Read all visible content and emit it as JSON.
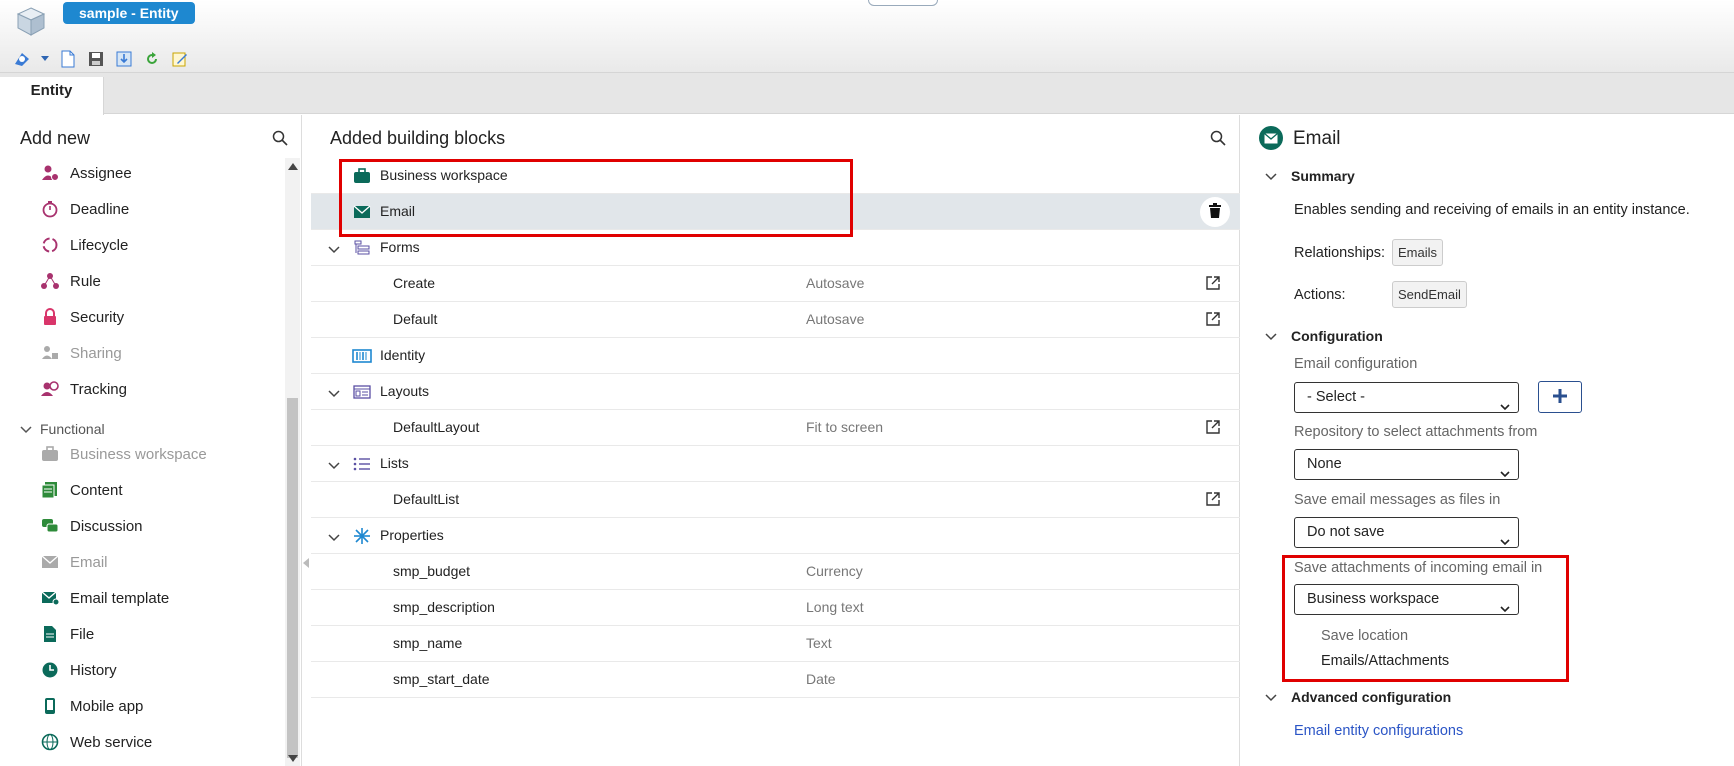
{
  "window": {
    "title": "sample - Entity"
  },
  "tabs": [
    {
      "label": "Entity",
      "active": true
    }
  ],
  "left_panel": {
    "title": "Add new",
    "items": [
      {
        "label": "Assignee",
        "icon": "person-check-icon",
        "disabled": false
      },
      {
        "label": "Deadline",
        "icon": "stopwatch-icon",
        "disabled": false
      },
      {
        "label": "Lifecycle",
        "icon": "cycle-icon",
        "disabled": false
      },
      {
        "label": "Rule",
        "icon": "rule-icon",
        "disabled": false
      },
      {
        "label": "Security",
        "icon": "lock-icon",
        "disabled": false
      },
      {
        "label": "Sharing",
        "icon": "sharing-icon",
        "disabled": true
      },
      {
        "label": "Tracking",
        "icon": "tracking-icon",
        "disabled": false
      }
    ],
    "group_label": "Functional",
    "functional_items": [
      {
        "label": "Business workspace",
        "icon": "briefcase-icon",
        "disabled": true
      },
      {
        "label": "Content",
        "icon": "content-icon",
        "disabled": false
      },
      {
        "label": "Discussion",
        "icon": "chat-icon",
        "disabled": false
      },
      {
        "label": "Email",
        "icon": "envelope-icon",
        "disabled": true
      },
      {
        "label": "Email template",
        "icon": "email-template-icon",
        "disabled": false
      },
      {
        "label": "File",
        "icon": "file-icon",
        "disabled": false
      },
      {
        "label": "History",
        "icon": "clock-icon",
        "disabled": false
      },
      {
        "label": "Mobile app",
        "icon": "mobile-icon",
        "disabled": false
      },
      {
        "label": "Web service",
        "icon": "globe-icon",
        "disabled": false
      }
    ]
  },
  "middle_panel": {
    "title": "Added building blocks",
    "rows": [
      {
        "label": "Business workspace",
        "meta": "",
        "level": 0,
        "expandable": false,
        "icon": "briefcase-icon"
      },
      {
        "label": "Email",
        "meta": "",
        "level": 0,
        "expandable": false,
        "icon": "envelope-icon",
        "selected": true
      },
      {
        "label": "Forms",
        "meta": "",
        "level": 0,
        "expandable": true,
        "icon": "forms-icon"
      },
      {
        "label": "Create",
        "meta": "Autosave",
        "level": 1,
        "external": true
      },
      {
        "label": "Default",
        "meta": "Autosave",
        "level": 1,
        "external": true
      },
      {
        "label": "Identity",
        "meta": "",
        "level": 0,
        "expandable": false,
        "icon": "identity-icon"
      },
      {
        "label": "Layouts",
        "meta": "",
        "level": 0,
        "expandable": true,
        "icon": "layouts-icon"
      },
      {
        "label": "DefaultLayout",
        "meta": "Fit to screen",
        "level": 1,
        "external": true
      },
      {
        "label": "Lists",
        "meta": "",
        "level": 0,
        "expandable": true,
        "icon": "list-icon"
      },
      {
        "label": "DefaultList",
        "meta": "",
        "level": 1,
        "external": true
      },
      {
        "label": "Properties",
        "meta": "",
        "level": 0,
        "expandable": true,
        "icon": "properties-icon"
      },
      {
        "label": "smp_budget",
        "meta": "Currency",
        "level": 1
      },
      {
        "label": "smp_description",
        "meta": "Long text",
        "level": 1
      },
      {
        "label": "smp_name",
        "meta": "Text",
        "level": 1
      },
      {
        "label": "smp_start_date",
        "meta": "Date",
        "level": 1
      }
    ]
  },
  "right_panel": {
    "title": "Email",
    "summary": {
      "heading": "Summary",
      "description": "Enables sending and receiving of emails in an entity instance.",
      "relationships_label": "Relationships:",
      "relationships_value": "Emails",
      "actions_label": "Actions:",
      "actions_value": "SendEmail"
    },
    "configuration": {
      "heading": "Configuration",
      "email_config_label": "Email configuration",
      "email_config_value": "- Select -",
      "repo_label": "Repository to select attachments from",
      "repo_value": "None",
      "save_messages_label": "Save email messages as files in",
      "save_messages_value": "Do not save",
      "save_attachments_label": "Save attachments of incoming email in",
      "save_attachments_value": "Business workspace",
      "save_location_label": "Save location",
      "save_location_value": "Emails/Attachments"
    },
    "advanced": {
      "heading": "Advanced configuration",
      "link": "Email entity configurations"
    }
  },
  "colors": {
    "accent_blue": "#1e88d0",
    "highlight_red": "#e00000",
    "email_green": "#0b6a5a",
    "link_blue": "#2b55c6"
  }
}
